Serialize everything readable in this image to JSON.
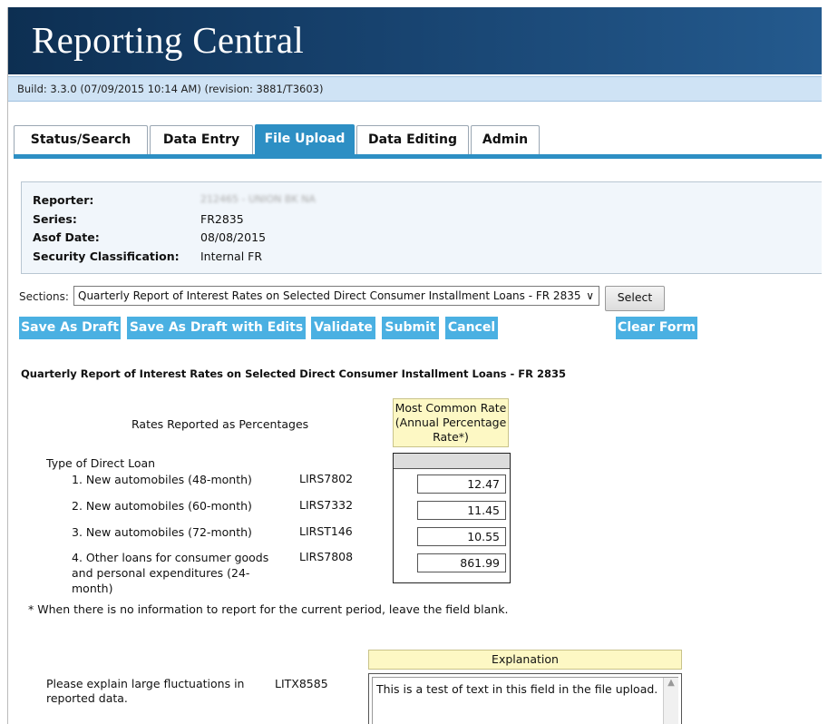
{
  "app": {
    "title": "Reporting Central"
  },
  "build": {
    "text": "Build: 3.3.0 (07/09/2015 10:14 AM) (revision: 3881/T3603)"
  },
  "tabs": [
    {
      "label": "Status/Search",
      "active": false
    },
    {
      "label": "Data Entry",
      "active": false
    },
    {
      "label": "File Upload",
      "active": true
    },
    {
      "label": "Data Editing",
      "active": false
    },
    {
      "label": "Admin",
      "active": false
    }
  ],
  "info": {
    "reporter_label": "Reporter:",
    "reporter_value": "212465 - UNION BK NA",
    "series_label": "Series:",
    "series_value": "FR2835",
    "asof_label": "Asof Date:",
    "asof_value": "08/08/2015",
    "security_label": "Security Classification:",
    "security_value": "Internal FR"
  },
  "sections": {
    "label": "Sections:",
    "selected": "Quarterly Report of Interest Rates on Selected Direct Consumer Installment Loans - FR 2835",
    "select_button": "Select"
  },
  "actions": {
    "save_draft": "Save As Draft",
    "save_draft_edits": "Save As Draft with Edits",
    "validate": "Validate",
    "submit": "Submit",
    "cancel": "Cancel",
    "clear_form": "Clear Form"
  },
  "form": {
    "title": "Quarterly Report of Interest Rates on Selected Direct Consumer Installment Loans - FR 2835",
    "rates_label": "Rates Reported as Percentages",
    "column_header": "Most Common Rate (Annual Percentage Rate*)",
    "type_label": "Type of Direct Loan",
    "rows": [
      {
        "label": "1. New automobiles (48-month)",
        "code": "LIRS7802",
        "value": "12.47"
      },
      {
        "label": "2. New automobiles (60-month)",
        "code": "LIRS7332",
        "value": "11.45"
      },
      {
        "label": "3. New automobiles (72-month)",
        "code": "LIRST146",
        "value": "10.55"
      },
      {
        "label": "4. Other loans for consumer goods and personal expenditures (24-month)",
        "code": "LIRS7808",
        "value": "861.99"
      }
    ],
    "note": "* When there is no information to report for the current period, leave the field blank."
  },
  "explanation": {
    "header": "Explanation",
    "question": "Please explain large fluctuations in reported data.",
    "code": "LITX8585",
    "value": "This is a test of text in this field in the file upload."
  }
}
